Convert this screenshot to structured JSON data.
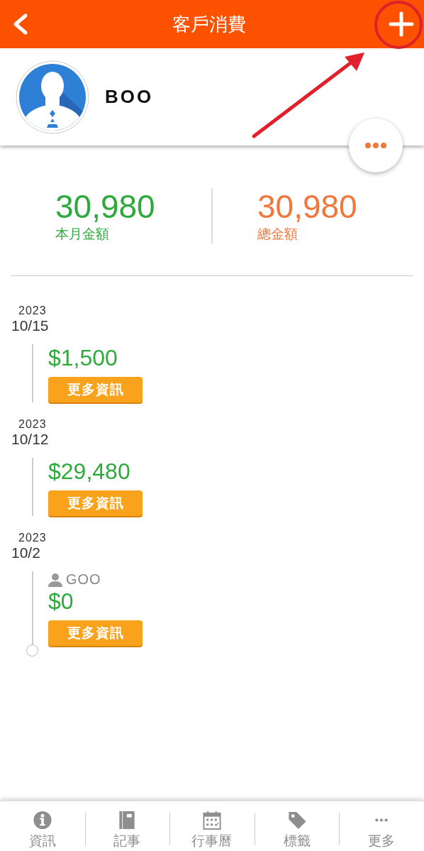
{
  "header": {
    "title": "客戶消費"
  },
  "customer": {
    "name": "BOO"
  },
  "stats": [
    {
      "kind": "month",
      "value": "30,980",
      "label": "本月金額"
    },
    {
      "kind": "total",
      "value": "30,980",
      "label": "總金額"
    }
  ],
  "entries": [
    {
      "year": "2023",
      "date": "10/15",
      "amount": "$1,500",
      "button": "更多資訊"
    },
    {
      "year": "2023",
      "date": "10/12",
      "amount": "$29,480",
      "button": "更多資訊"
    },
    {
      "year": "2023",
      "date": "10/2",
      "user": "GOO",
      "amount": "$0",
      "button": "更多資訊"
    }
  ],
  "tabs": [
    {
      "kind": "info",
      "label": "資訊"
    },
    {
      "kind": "notes",
      "label": "記事"
    },
    {
      "kind": "calendar",
      "label": "行事曆"
    },
    {
      "kind": "tag",
      "label": "標籤"
    },
    {
      "kind": "more",
      "label": "更多"
    }
  ]
}
